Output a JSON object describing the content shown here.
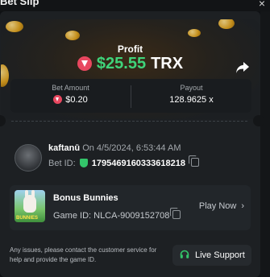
{
  "window": {
    "title": "Bet Slip",
    "close_label": "×"
  },
  "hero": {
    "profit_label": "Profit",
    "profit_amount": "$25.55",
    "profit_currency": "TRX",
    "currency_icon": "trx-coin-icon",
    "share_icon": "share-arrow-icon",
    "colors": {
      "profit_green": "#3fd47a",
      "trx_red": "#e8475f"
    }
  },
  "stats": {
    "bet_amount_label": "Bet Amount",
    "bet_amount_value": "$0.20",
    "payout_label": "Payout",
    "payout_value": "128.9625 x"
  },
  "bet": {
    "username": "kaftanū",
    "timestamp": "On 4/5/2024, 6:53:44 AM",
    "bet_id_label": "Bet ID:",
    "bet_id": "1795469160333618218",
    "verified_icon": "shield-check-icon",
    "copy_icon": "copy-icon"
  },
  "game": {
    "name": "Bonus Bunnies",
    "id_text": "Game ID: NLCA-9009152708",
    "thumb_text": "BUNNIES",
    "play_label": "Play Now",
    "play_icon": "chevron-right-icon"
  },
  "footer": {
    "notice": "Any issues, please contact the customer service for help and provide the game ID.",
    "support_label": "Live Support",
    "support_icon": "headset-icon",
    "support_icon_color": "#33c56a"
  }
}
